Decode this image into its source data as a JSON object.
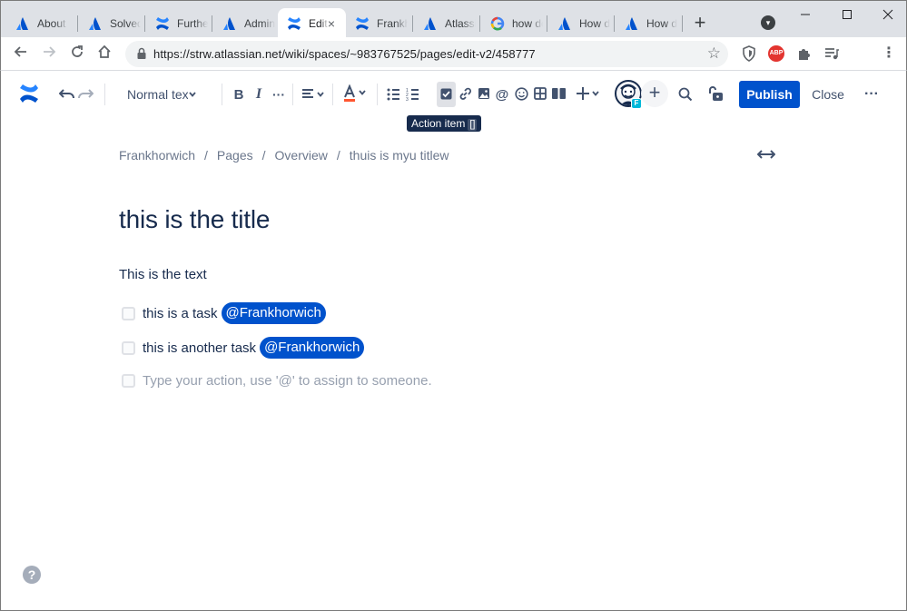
{
  "browser": {
    "tabs": [
      {
        "title": "About t",
        "favicon": "atlassian-icon"
      },
      {
        "title": "Solved",
        "favicon": "atlassian-icon"
      },
      {
        "title": "Furthe",
        "favicon": "confluence-icon"
      },
      {
        "title": "Admin",
        "favicon": "atlassian-icon"
      },
      {
        "title": "Edit",
        "favicon": "confluence-icon",
        "active": true
      },
      {
        "title": "Frankh",
        "favicon": "confluence-icon"
      },
      {
        "title": "Atlassi",
        "favicon": "atlassian-icon"
      },
      {
        "title": "how do",
        "favicon": "google-icon"
      },
      {
        "title": "How d",
        "favicon": "atlassian-icon"
      },
      {
        "title": "How d",
        "favicon": "atlassian-icon"
      }
    ],
    "new_tab_label": "+",
    "close_glyph": "×",
    "url": "https://strw.atlassian.net/wiki/spaces/~983767525/pages/edit-v2/458777",
    "extension_abp_label": "ABP"
  },
  "editor_toolbar": {
    "text_style": "Normal text",
    "publish_label": "Publish",
    "close_label": "Close",
    "avatar_badge": "F",
    "tooltip": {
      "label": "Action item",
      "shortcut": "[]"
    }
  },
  "page": {
    "breadcrumb": [
      "Frankhorwich",
      "Pages",
      "Overview",
      "thuis is myu titlew"
    ],
    "breadcrumb_sep": "/",
    "title": "this is the title",
    "paragraph": "This is the text",
    "tasks": [
      {
        "text": "this is a task",
        "mention": "@Frankhorwich"
      },
      {
        "text": "this is another task",
        "mention": "@Frankhorwich"
      }
    ],
    "task_placeholder": "Type your action, use '@' to assign to someone."
  },
  "help_glyph": "?",
  "colors": {
    "brand_blue": "#0052cc",
    "text_dark": "#172b4d",
    "text_subtle": "#6b778c",
    "tooltip_bg": "#172b4d"
  }
}
